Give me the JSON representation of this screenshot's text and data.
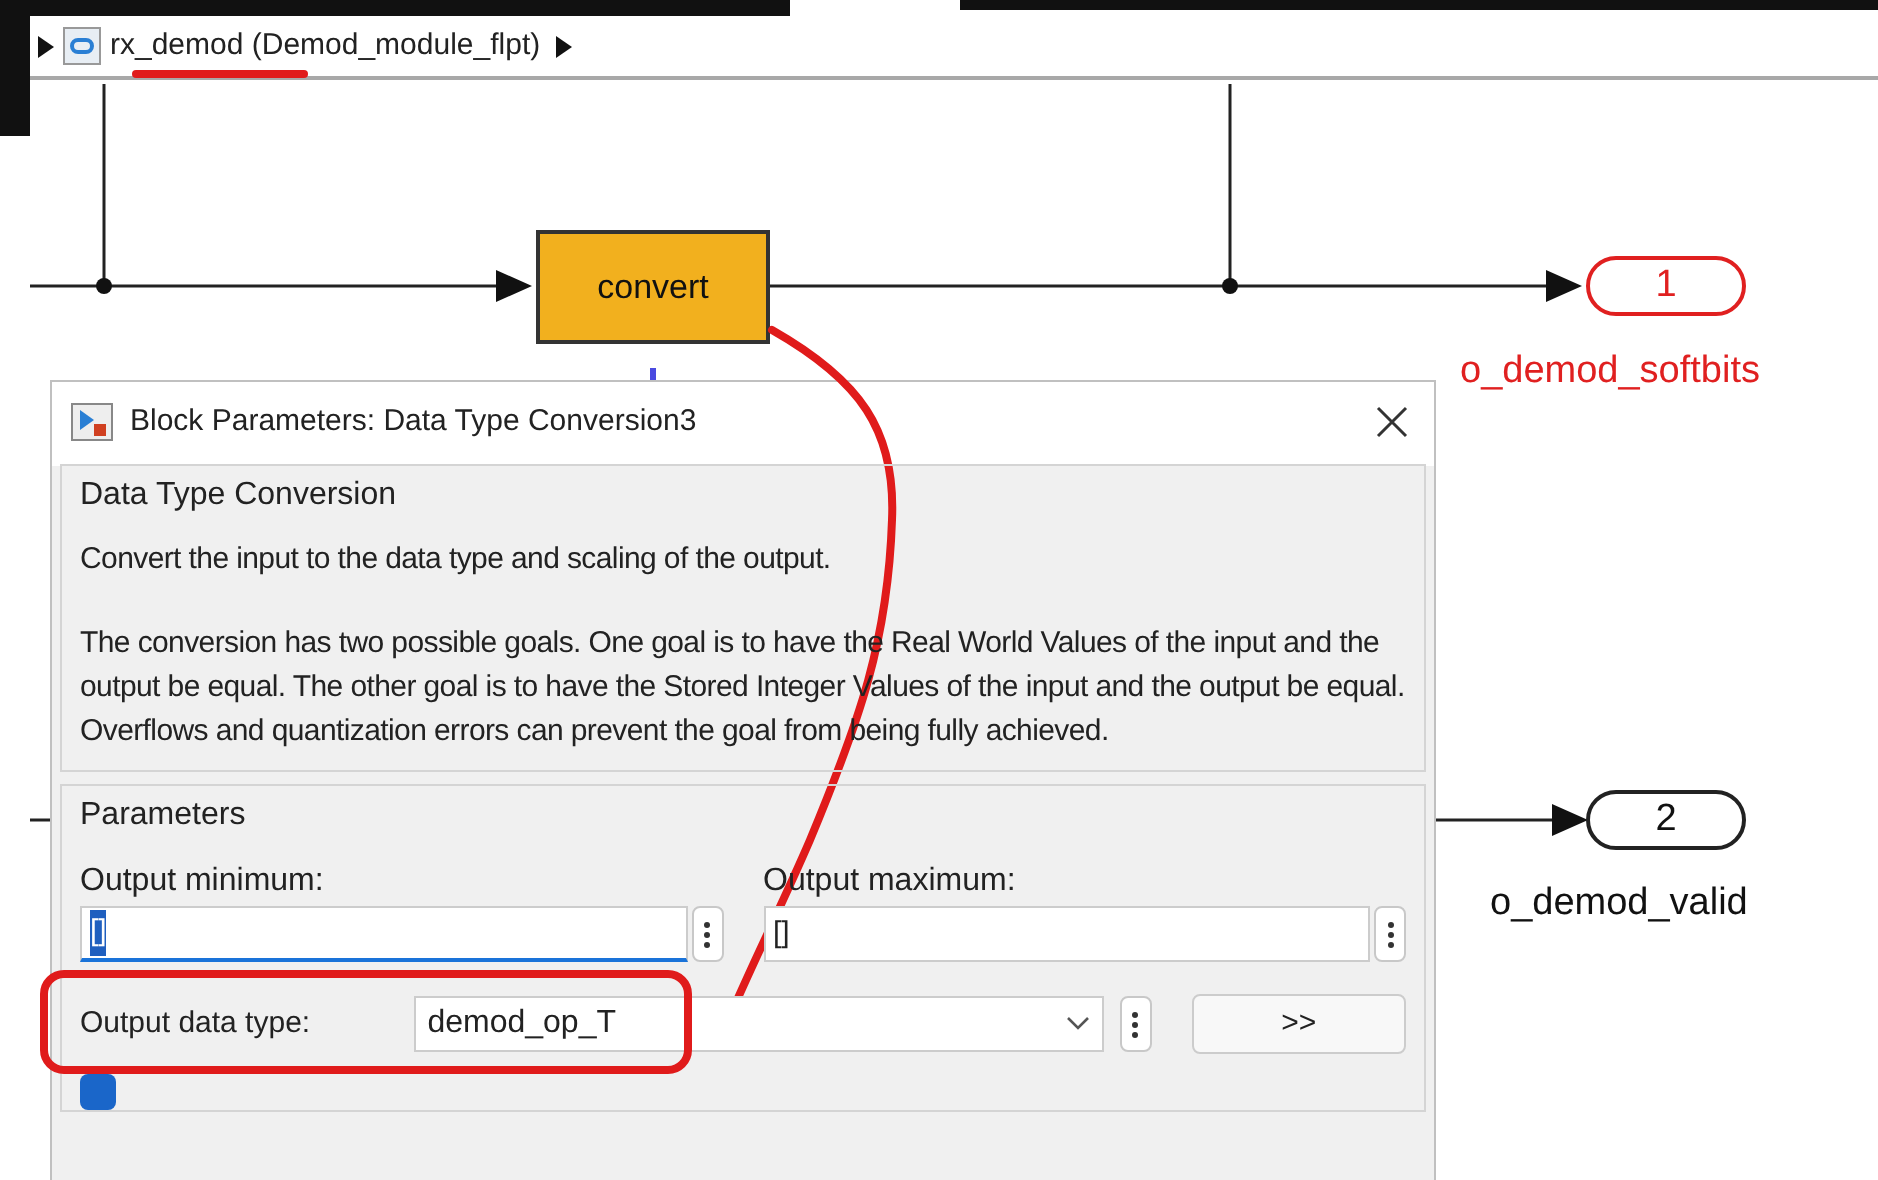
{
  "breadcrumb": {
    "model": "rx_demod (Demod_module_flpt)"
  },
  "diagram": {
    "blocks": [
      {
        "label": "convert"
      }
    ],
    "outports": [
      {
        "number": "1",
        "label": "o_demod_softbits",
        "highlighted": true
      },
      {
        "number": "2",
        "label": "o_demod_valid",
        "highlighted": false
      }
    ]
  },
  "dialog": {
    "title": "Block Parameters: Data Type Conversion3",
    "group": "Data Type Conversion",
    "description": [
      "Convert the input to the data type and scaling of the output.",
      "The conversion has two possible goals. One goal is to have the Real World Values of the input and the output be equal.  The other goal is to have the Stored Integer Values of the input and the output be equal.  Overflows and quantization errors can prevent the goal from being fully achieved."
    ],
    "parameters": {
      "title": "Parameters",
      "output_minimum": {
        "label": "Output minimum:",
        "value": "[]",
        "selected": true
      },
      "output_maximum": {
        "label": "Output maximum:",
        "value": "[]",
        "selected": false
      },
      "output_data_type": {
        "label": "Output data type:",
        "value": "demod_op_T"
      },
      "assistant_button": ">>",
      "checkbox": {
        "checked": true
      }
    }
  }
}
